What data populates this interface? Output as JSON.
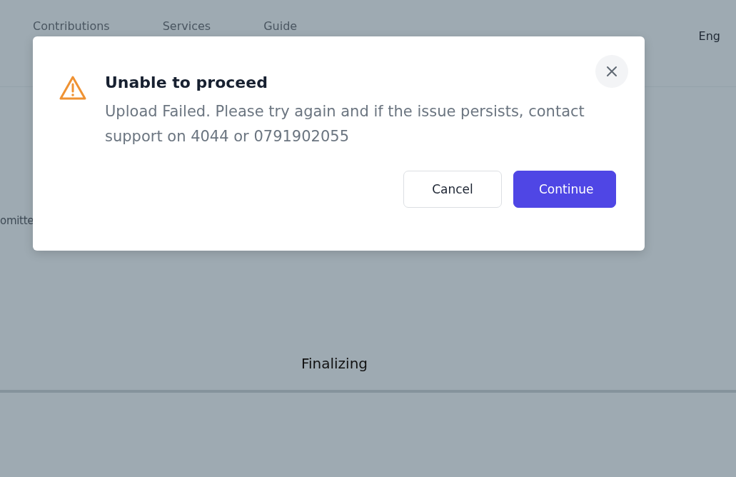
{
  "header": {
    "nav_items": [
      {
        "label": "Contributions"
      },
      {
        "label": "Services"
      },
      {
        "label": "Guide"
      }
    ],
    "language": "Eng"
  },
  "page": {
    "partial_text": "omitte",
    "progress_label": "Finalizing"
  },
  "dialog": {
    "title": "Unable to proceed",
    "message": "Upload Failed. Please try again and if the issue persists, contact support on 4044 or 0791902055",
    "buttons": [
      {
        "label": "Cancel",
        "kind": "secondary"
      },
      {
        "label": "Continue",
        "kind": "primary"
      }
    ]
  }
}
